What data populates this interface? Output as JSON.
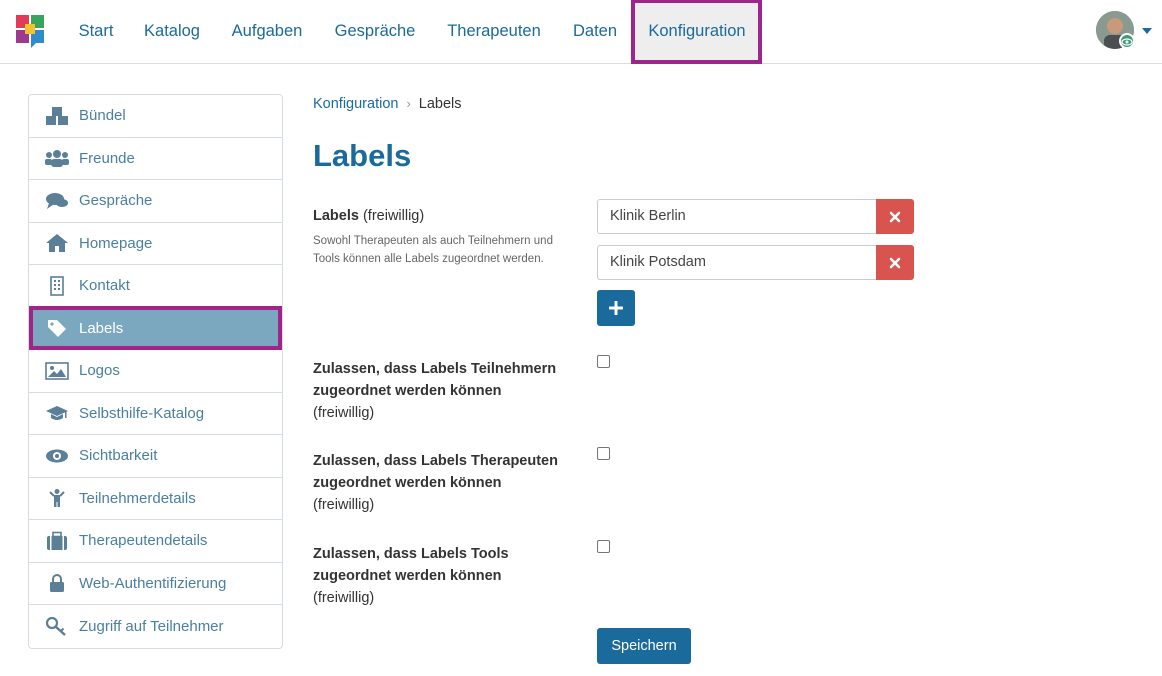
{
  "nav": {
    "items": [
      "Start",
      "Katalog",
      "Aufgaben",
      "Gespräche",
      "Therapeuten",
      "Daten",
      "Konfiguration"
    ],
    "active": "Konfiguration"
  },
  "sidebar": {
    "items": [
      {
        "label": "Bündel",
        "icon": "cubes-icon"
      },
      {
        "label": "Freunde",
        "icon": "users-icon"
      },
      {
        "label": "Gespräche",
        "icon": "comments-icon"
      },
      {
        "label": "Homepage",
        "icon": "home-icon"
      },
      {
        "label": "Kontakt",
        "icon": "building-icon"
      },
      {
        "label": "Labels",
        "icon": "tag-icon"
      },
      {
        "label": "Logos",
        "icon": "image-icon"
      },
      {
        "label": "Selbsthilfe-Katalog",
        "icon": "graduation-cap-icon"
      },
      {
        "label": "Sichtbarkeit",
        "icon": "eye-icon"
      },
      {
        "label": "Teilnehmerdetails",
        "icon": "child-icon"
      },
      {
        "label": "Therapeutendetails",
        "icon": "suitcase-icon"
      },
      {
        "label": "Web-Authentifizierung",
        "icon": "lock-icon"
      },
      {
        "label": "Zugriff auf Teilnehmer",
        "icon": "key-icon"
      }
    ],
    "active": "Labels"
  },
  "breadcrumb": {
    "parent": "Konfiguration",
    "separator": "›",
    "current": "Labels"
  },
  "page_title": "Labels",
  "labels_field": {
    "label": "Labels",
    "optional": "(freiwillig)",
    "help": "Sowohl Therapeuten als auch Teilnehmern und Tools können alle Labels zugeordnet werden.",
    "values": [
      "Klinik Berlin",
      "Klinik Potsdam"
    ]
  },
  "checkbox_fields": [
    {
      "label": "Zulassen, dass Labels Teilnehmern zugeordnet werden können",
      "optional": "(freiwillig)",
      "checked": false
    },
    {
      "label": "Zulassen, dass Labels Therapeuten zugeordnet werden können",
      "optional": "(freiwillig)",
      "checked": false
    },
    {
      "label": "Zulassen, dass Labels Tools zugeordnet werden können",
      "optional": "(freiwillig)",
      "checked": false
    }
  ],
  "save_label": "Speichern",
  "colors": {
    "primary": "#1b6a9c",
    "danger": "#d9534f",
    "highlight": "#a0258a",
    "sidebar_active": "#7ba8bf"
  }
}
